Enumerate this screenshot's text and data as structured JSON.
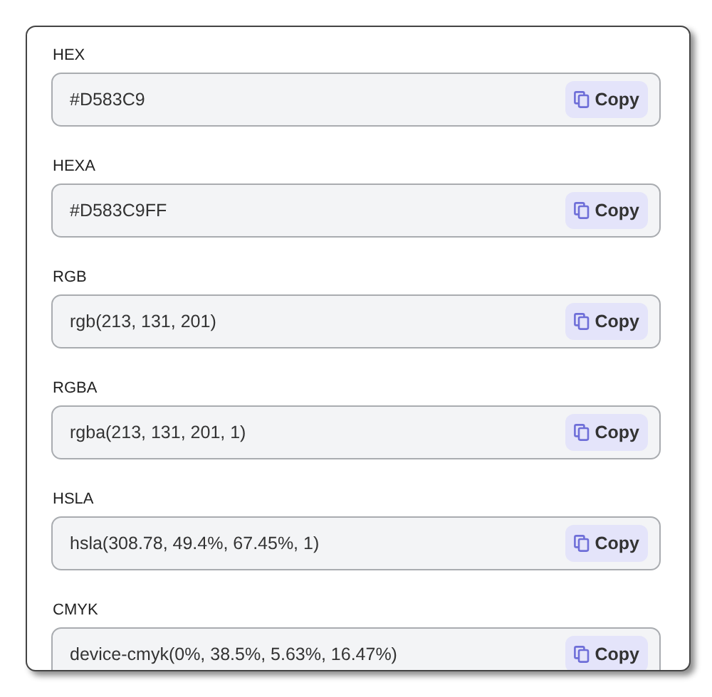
{
  "formats": [
    {
      "label": "HEX",
      "value": "#D583C9",
      "button": "Copy"
    },
    {
      "label": "HEXA",
      "value": "#D583C9FF",
      "button": "Copy"
    },
    {
      "label": "RGB",
      "value": "rgb(213, 131, 201)",
      "button": "Copy"
    },
    {
      "label": "RGBA",
      "value": "rgba(213, 131, 201, 1)",
      "button": "Copy"
    },
    {
      "label": "HSLA",
      "value": "hsla(308.78, 49.4%, 67.45%, 1)",
      "button": "Copy"
    },
    {
      "label": "CMYK",
      "value": "device-cmyk(0%, 38.5%, 5.63%, 16.47%)",
      "button": "Copy"
    }
  ]
}
